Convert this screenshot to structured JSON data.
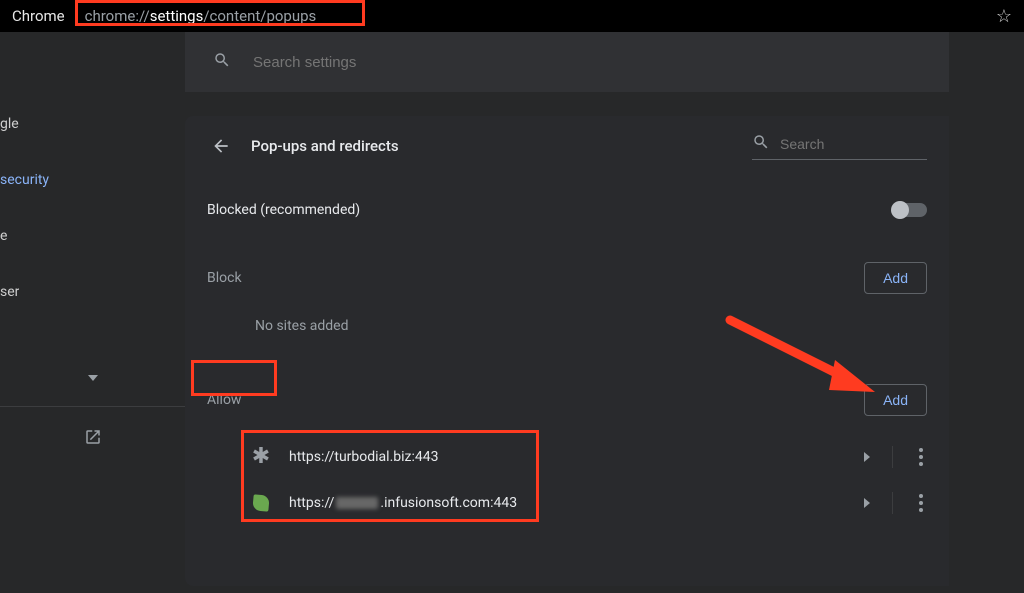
{
  "browser": {
    "name": "Chrome",
    "url_prefix": "chrome://",
    "url_strong": "settings",
    "url_suffix": "/content/popups"
  },
  "searchbar": {
    "placeholder": "Search settings"
  },
  "sidebar": {
    "items": [
      {
        "label": "gle"
      },
      {
        "label": "security"
      },
      {
        "label": "e"
      },
      {
        "label": "ser"
      }
    ]
  },
  "page": {
    "title": "Pop-ups and redirects",
    "search_placeholder": "Search",
    "blocked_label": "Blocked (recommended)",
    "block_section": "Block",
    "block_empty": "No sites added",
    "allow_section": "Allow",
    "add_label": "Add",
    "allow_sites": [
      {
        "icon": "wildcard",
        "url_pre": "https://turbodial.biz:443",
        "url_post": ""
      },
      {
        "icon": "leaf",
        "url_pre": "https://",
        "url_post": ".infusionsoft.com:443"
      }
    ]
  }
}
